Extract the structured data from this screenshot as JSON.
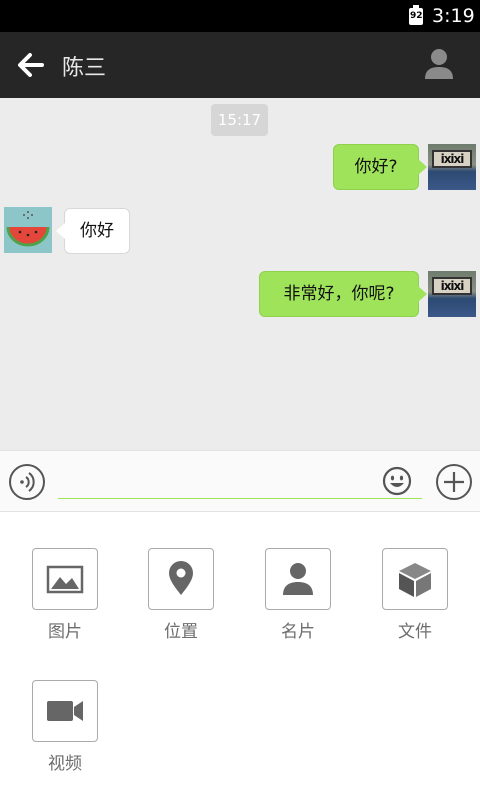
{
  "status_bar": {
    "battery": "92",
    "time": "3:19"
  },
  "header": {
    "title": "陈三",
    "back_icon": "arrow-left-icon",
    "profile_icon": "person-icon"
  },
  "chat": {
    "timestamp": "15:17",
    "messages": [
      {
        "side": "out",
        "text": "你好?"
      },
      {
        "side": "in",
        "text": "你好"
      },
      {
        "side": "out",
        "text": "非常好，你呢?"
      }
    ],
    "self_avatar_sign": "ixixi"
  },
  "input_bar": {
    "value": "",
    "placeholder": ""
  },
  "tools": [
    {
      "label": "图片",
      "icon": "image-icon"
    },
    {
      "label": "位置",
      "icon": "location-pin-icon"
    },
    {
      "label": "名片",
      "icon": "contact-card-icon"
    },
    {
      "label": "文件",
      "icon": "box-file-icon"
    },
    {
      "label": "视频",
      "icon": "video-camera-icon"
    }
  ],
  "colors": {
    "header": "#262626",
    "chat_bg": "#ececec",
    "outgoing_bubble": "#9fe35b",
    "accent": "#9fe35b"
  }
}
